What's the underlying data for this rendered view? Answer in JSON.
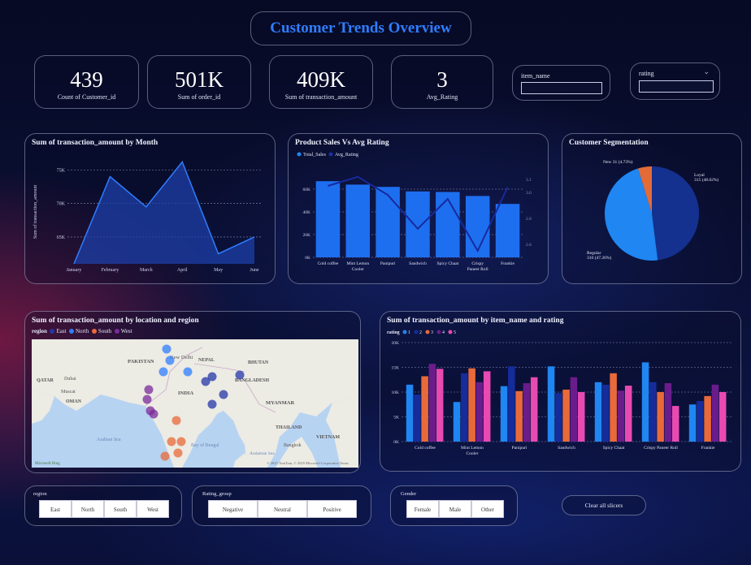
{
  "title": "Customer Trends Overview",
  "kpis": [
    {
      "value": "439",
      "label": "Count of Customer_id"
    },
    {
      "value": "501K",
      "label": "Sum of order_id"
    },
    {
      "value": "409K",
      "label": "Sum of transaction_amount"
    },
    {
      "value": "3",
      "label": "Avg_Rating"
    }
  ],
  "slicers": {
    "item_name": {
      "label": "item_name"
    },
    "rating": {
      "label": "rating"
    },
    "region": {
      "label": "region",
      "options": [
        "East",
        "North",
        "South",
        "West"
      ]
    },
    "rating_group": {
      "label": "Rating_group",
      "options": [
        "Negative",
        "Neutral",
        "Positive"
      ]
    },
    "gender": {
      "label": "Gender",
      "options": [
        "Female",
        "Male",
        "Other"
      ]
    },
    "clear_all": "Clear all slicers"
  },
  "colors": {
    "accent": "#2f7dff",
    "bar": "#1e6ff0",
    "line": "#1a2fa8",
    "south": "#e86a3a",
    "east": "#2535a8",
    "north": "#2f7dff",
    "west": "#7a2a9a"
  },
  "chart_data": [
    {
      "type": "area",
      "title": "Sum of transaction_amount by Month",
      "ylabel": "Sum of transaction_amount",
      "categories": [
        "January",
        "February",
        "March",
        "April",
        "May",
        "June"
      ],
      "values": [
        61000,
        74000,
        69500,
        76200,
        62500,
        65000
      ],
      "yticks": [
        "65K",
        "70K",
        "75K"
      ],
      "ylim": [
        61000,
        76500
      ],
      "grid": true
    },
    {
      "type": "bar",
      "title": "Product Sales Vs Avg Rating",
      "legend": [
        "Total_Sales",
        "Avg_Rating"
      ],
      "categories": [
        "Cold coffee",
        "Mint Lemon Cooler",
        "Panipuri",
        "Sandwich",
        "Spicy Chaat",
        "Crispy Paneer Roll",
        "Frankie"
      ],
      "category_labels": [
        [
          "Cold coffee"
        ],
        [
          "Mint Lemon",
          "Cooler"
        ],
        [
          "Panipuri"
        ],
        [
          "Sandwich"
        ],
        [
          "Spicy Chaat"
        ],
        [
          "Crispy",
          "Paneer Roll"
        ],
        [
          "Frankie"
        ]
      ],
      "series": [
        {
          "name": "Total_Sales",
          "values": [
            67000,
            64000,
            62000,
            58000,
            57500,
            54000,
            47000
          ]
        },
        {
          "name": "Avg_Rating",
          "values": [
            3.05,
            3.12,
            2.98,
            2.72,
            2.95,
            2.55,
            3.04
          ]
        }
      ],
      "yticks": [
        "0K",
        "20K",
        "40K",
        "60K"
      ],
      "y2ticks": [
        "2.6",
        "2.8",
        "3.0",
        "3.1"
      ]
    },
    {
      "type": "pie",
      "title": "Customer Segmentation",
      "labels": [
        "Loyal",
        "Regular",
        "New"
      ],
      "values": [
        48.02,
        47.26,
        4.73
      ],
      "data_labels": [
        "Loyal\n315 (48.02%)",
        "Regular\n310 (47.26%)",
        "New 31 (4.73%)"
      ],
      "colors": [
        "#14318f",
        "#1f86f2",
        "#e36b38"
      ]
    },
    {
      "type": "scatter",
      "title": "Sum of transaction_amount by location and region",
      "legend_title": "region",
      "legend": [
        "East",
        "North",
        "South",
        "West"
      ],
      "map_labels": [
        "PAKISTAN",
        "New Delhi",
        "NEPAL",
        "BHUTAN",
        "BANGLADESH",
        "INDIA",
        "MYANMAR",
        "OMAN",
        "QATAR",
        "Dubai",
        "Muscat",
        "THAILAND",
        "VIETNAM",
        "Bangkok",
        "Bay of Bengal",
        "Arabian Sea",
        "Andaman Sea"
      ],
      "credit": "© 2025 TomTom, © 2025 Microsoft Corporation  Terms"
    },
    {
      "type": "bar",
      "title": "Sum of transaction_amount by item_name and rating",
      "legend_title": "rating",
      "categories": [
        "Cold coffee",
        "Mint Lemon Cooler",
        "Panipuri",
        "Sandwich",
        "Spicy Chaat",
        "Crispy Paneer Roll",
        "Frankie"
      ],
      "category_labels": [
        [
          "Cold coffee"
        ],
        [
          "Mint Lemon",
          "Cooler"
        ],
        [
          "Panipuri"
        ],
        [
          "Sandwich"
        ],
        [
          "Spicy Chaat"
        ],
        [
          "Crispy Paneer Roll"
        ],
        [
          "Frankie"
        ]
      ],
      "series": [
        {
          "name": "1",
          "values": [
            11500,
            8000,
            11200,
            15200,
            12000,
            16000,
            7500
          ]
        },
        {
          "name": "2",
          "values": [
            9500,
            13800,
            15200,
            9800,
            11500,
            12000,
            8200
          ]
        },
        {
          "name": "3",
          "values": [
            13200,
            14800,
            10200,
            10500,
            13800,
            10000,
            9200
          ]
        },
        {
          "name": "4",
          "values": [
            15700,
            12000,
            11800,
            13000,
            10300,
            11800,
            11500
          ]
        },
        {
          "name": "5",
          "values": [
            14700,
            14200,
            13000,
            10000,
            11300,
            7200,
            10000
          ]
        }
      ],
      "series_colors": [
        "#1f86f2",
        "#152c9a",
        "#e86a3a",
        "#6b1c8c",
        "#e84ab2"
      ],
      "yticks": [
        "0K",
        "5K",
        "10K",
        "15K",
        "20K"
      ],
      "ylim": [
        0,
        20000
      ]
    }
  ]
}
